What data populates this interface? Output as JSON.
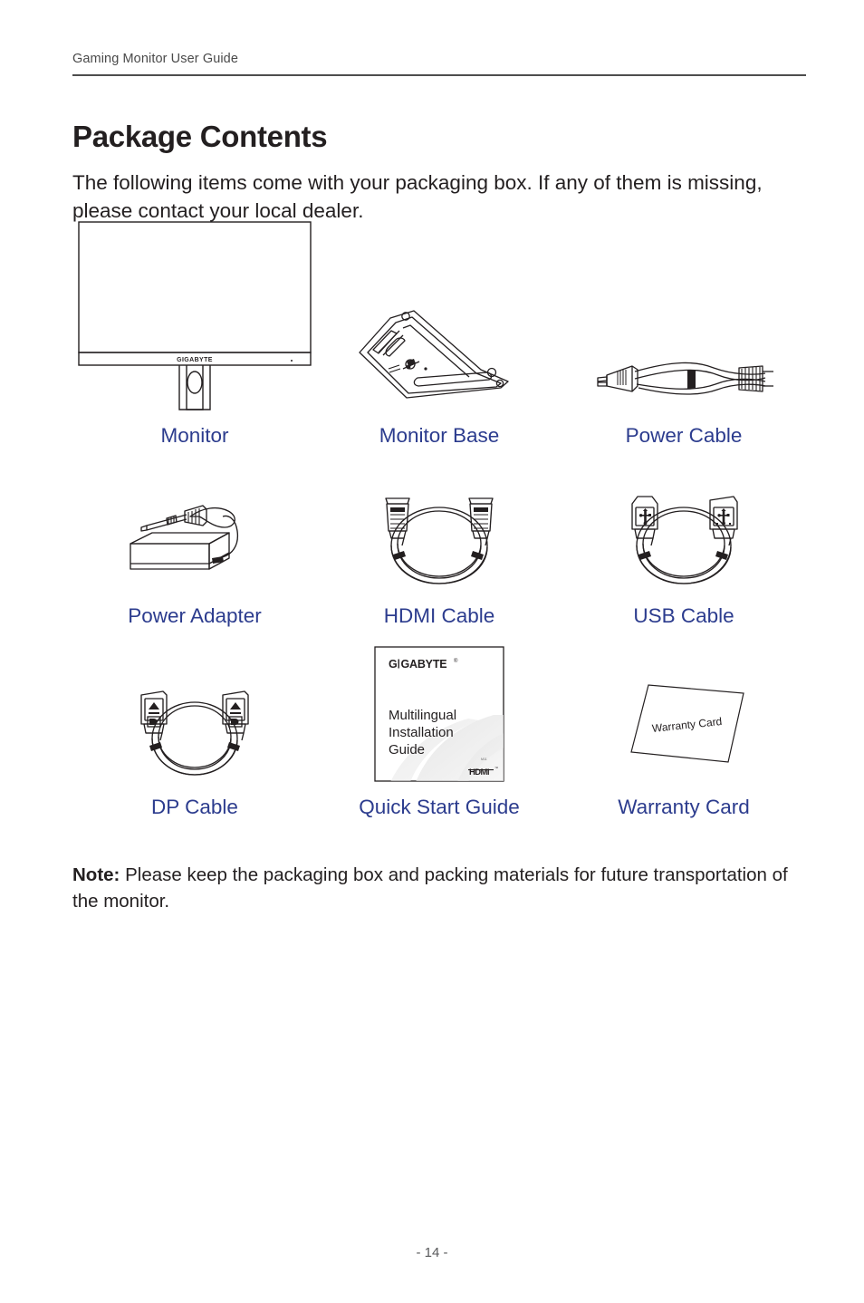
{
  "header": {
    "running_head": "Gaming Monitor User Guide"
  },
  "title": "Package Contents",
  "intro": "The following items come with your packaging box. If any of them is missing, please contact your local dealer.",
  "items": [
    {
      "label": "Monitor",
      "art": "monitor-illustration"
    },
    {
      "label": "Monitor Base",
      "art": "monitor-base-illustration"
    },
    {
      "label": "Power Cable",
      "art": "power-cable-illustration"
    },
    {
      "label": "Power Adapter",
      "art": "power-adapter-illustration"
    },
    {
      "label": "HDMI Cable",
      "art": "hdmi-cable-illustration"
    },
    {
      "label": "USB Cable",
      "art": "usb-cable-illustration"
    },
    {
      "label": "DP Cable",
      "art": "dp-cable-illustration"
    },
    {
      "label": "Quick Start Guide",
      "art": "quick-start-guide-illustration"
    },
    {
      "label": "Warranty Card",
      "art": "warranty-card-illustration"
    }
  ],
  "monitor_art": {
    "brand": "GIGABYTE"
  },
  "quick_start_guide_art": {
    "brand": "G|GABYTE",
    "trademark": "®",
    "line1": "Multilingual",
    "line2": "Installation",
    "line3": "Guide",
    "hdmi_logo": "HDMI",
    "fine_print": "M11"
  },
  "warranty_card_art": {
    "text": "Warranty Card"
  },
  "note": {
    "prefix": "Note:",
    "body": " Please keep the packaging box and packing materials for future transportation of the monitor."
  },
  "footer": {
    "page_number": "- 14 -"
  },
  "colors": {
    "label_blue": "#2c3c8e",
    "body_text": "#231f20",
    "rule": "#4d4d4d",
    "header_text": "#4a4a4a",
    "footer_text": "#58595b",
    "line_art": "#231f20"
  }
}
